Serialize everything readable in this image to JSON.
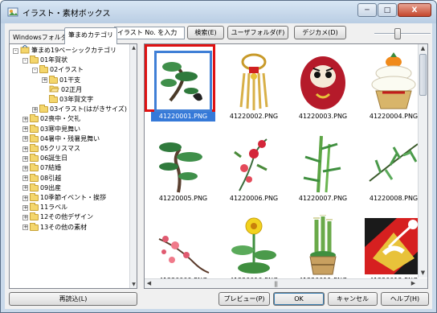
{
  "window": {
    "title": "イラスト・素材ボックス",
    "controls": {
      "minimize": "─",
      "maximize": "□",
      "close": "X"
    }
  },
  "tabs": [
    {
      "label": "Windowsフォルダ",
      "active": false
    },
    {
      "label": "筆まめカテゴリ",
      "active": true
    }
  ],
  "toolbar": {
    "search_value": "イラスト No. を入力",
    "search_button": "検索(E)",
    "user_folder_button": "ユーザフォルダ(F)",
    "digicam_button": "デジカメ(D)",
    "zoom_level": 0.4
  },
  "tree": {
    "items": [
      {
        "label": "筆まめ19ベーシックカテゴリ",
        "depth": 0,
        "expander": "-",
        "icon": "category-root-icon"
      },
      {
        "label": "01年賀状",
        "depth": 1,
        "expander": "-",
        "icon": "folder-icon"
      },
      {
        "label": "02イラスト",
        "depth": 2,
        "expander": "-",
        "icon": "folder-icon"
      },
      {
        "label": "01干支",
        "depth": 3,
        "expander": "+",
        "icon": "folder-icon"
      },
      {
        "label": "02正月",
        "depth": 3,
        "expander": "",
        "icon": "folder-open-icon",
        "selected": true
      },
      {
        "label": "03年賀文字",
        "depth": 3,
        "expander": "",
        "icon": "folder-icon"
      },
      {
        "label": "03イラスト(はがきサイズ)",
        "depth": 2,
        "expander": "+",
        "icon": "folder-icon"
      },
      {
        "label": "02喪中・欠礼",
        "depth": 1,
        "expander": "+",
        "icon": "folder-icon"
      },
      {
        "label": "03寒中見舞い",
        "depth": 1,
        "expander": "+",
        "icon": "folder-icon"
      },
      {
        "label": "04暑中・残暑見舞い",
        "depth": 1,
        "expander": "+",
        "icon": "folder-icon"
      },
      {
        "label": "05クリスマス",
        "depth": 1,
        "expander": "+",
        "icon": "folder-icon"
      },
      {
        "label": "06誕生日",
        "depth": 1,
        "expander": "+",
        "icon": "folder-icon"
      },
      {
        "label": "07結婚",
        "depth": 1,
        "expander": "+",
        "icon": "folder-icon"
      },
      {
        "label": "08引越",
        "depth": 1,
        "expander": "+",
        "icon": "folder-icon"
      },
      {
        "label": "09出産",
        "depth": 1,
        "expander": "+",
        "icon": "folder-icon"
      },
      {
        "label": "10季節イベント・挨拶",
        "depth": 1,
        "expander": "+",
        "icon": "folder-icon"
      },
      {
        "label": "11ラベル",
        "depth": 1,
        "expander": "+",
        "icon": "folder-icon"
      },
      {
        "label": "12その他デザイン",
        "depth": 1,
        "expander": "+",
        "icon": "folder-icon"
      },
      {
        "label": "13その他の素材",
        "depth": 1,
        "expander": "+",
        "icon": "folder-icon"
      }
    ]
  },
  "thumbnails": [
    {
      "filename": "41220001.PNG",
      "icon": "pine-bonsai-icon",
      "selected": true
    },
    {
      "filename": "41220002.PNG",
      "icon": "straw-ornament-icon"
    },
    {
      "filename": "41220003.PNG",
      "icon": "daruma-icon"
    },
    {
      "filename": "41220004.PNG",
      "icon": "kagami-mochi-icon"
    },
    {
      "filename": "41220005.PNG",
      "icon": "pine-tree-icon"
    },
    {
      "filename": "41220006.PNG",
      "icon": "plum-blossom-icon"
    },
    {
      "filename": "41220007.PNG",
      "icon": "bamboo-icon"
    },
    {
      "filename": "41220008.PNG",
      "icon": "bamboo-branch-icon"
    },
    {
      "filename": "41220009.PNG",
      "icon": "plum-branch-icon"
    },
    {
      "filename": "41220010.PNG",
      "icon": "yellow-flower-icon"
    },
    {
      "filename": "41220011.PNG",
      "icon": "kadomatsu-icon"
    },
    {
      "filename": "41220012.PNG",
      "icon": "crane-icon"
    }
  ],
  "buttons": {
    "reload": "再読込(L)",
    "preview": "プレビュー(P)",
    "ok": "OK",
    "cancel": "キャンセル",
    "help": "ヘルプ(H)"
  },
  "colors": {
    "selection_frame": "#e01212",
    "selection_caption": "#3579d8"
  }
}
